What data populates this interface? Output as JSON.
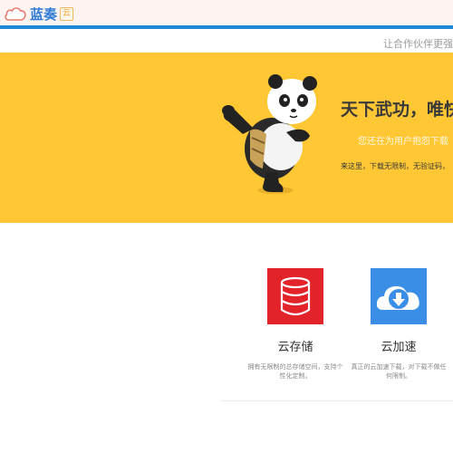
{
  "header": {
    "logo_text": "蓝奏",
    "logo_badge": "云"
  },
  "subbar": {
    "partner_text": "让合作伙伴更强"
  },
  "hero": {
    "title": "天下武功，唯快",
    "subtitle": "您还在为用户抱怨下载",
    "description": "来这里，下载无限制，无验证码，"
  },
  "features": [
    {
      "icon": "database-icon",
      "title": "云存储",
      "description": "拥有无限制的总存储空间，支持个性化定制。",
      "color": "#e2232a"
    },
    {
      "icon": "cloud-download-icon",
      "title": "云加速",
      "description": "真正的云加速下载，对下载不做任何限制。",
      "color": "#3a8ee6"
    }
  ],
  "colors": {
    "hero_bg": "#fec733",
    "brand_blue": "#1e88d6",
    "topbar_bg": "#fdf3f1"
  }
}
